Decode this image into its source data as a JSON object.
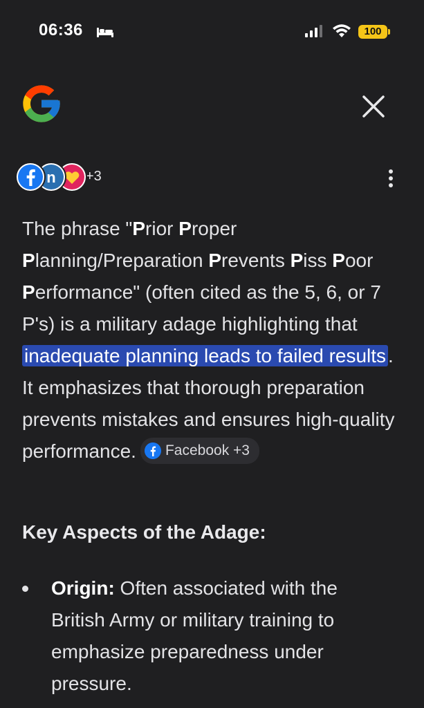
{
  "status_bar": {
    "time": "06:36",
    "battery": "100",
    "icons": [
      "bed-icon",
      "signal-icon",
      "wifi-icon",
      "battery-icon"
    ],
    "battery_color": "#f5c518"
  },
  "header": {
    "logo": "google-g-logo",
    "close_icon": "close-icon"
  },
  "sources": {
    "avatars": [
      "facebook-icon",
      "n-source-icon",
      "heart-source-icon"
    ],
    "more_label": "+3",
    "menu_icon": "more-vertical-icon"
  },
  "answer": {
    "p1": "The phrase \"",
    "p_prior": "P",
    "p2": "rior ",
    "p_proper": "P",
    "p3": "roper ",
    "p_planning": "P",
    "p4": "lanning/Preparation ",
    "p_prevents": "P",
    "p5": "revents ",
    "p_piss": "P",
    "p6": "iss ",
    "p_poor": "P",
    "p7": "oor ",
    "p_performance": "P",
    "p8": "erformance\" (often cited as the 5, 6, or 7 P's) is a military adage highlighting that ",
    "highlight": "inadequate planning leads to failed results",
    "p9": ". It emphasizes that thorough preparation prevents mistakes and ensures high-quality performance.",
    "chip_label": "Facebook +3",
    "highlight_color": "#2a4ab0"
  },
  "section": {
    "heading": "Key Aspects of the Adage:"
  },
  "bullets": [
    {
      "term": "Origin:",
      "text": " Often associated with the British Army or military training to emphasize preparedness under pressure."
    }
  ],
  "colors": {
    "background": "#1f1f21",
    "text": "#e3e3e6",
    "chip_bg": "#2d2d31"
  }
}
